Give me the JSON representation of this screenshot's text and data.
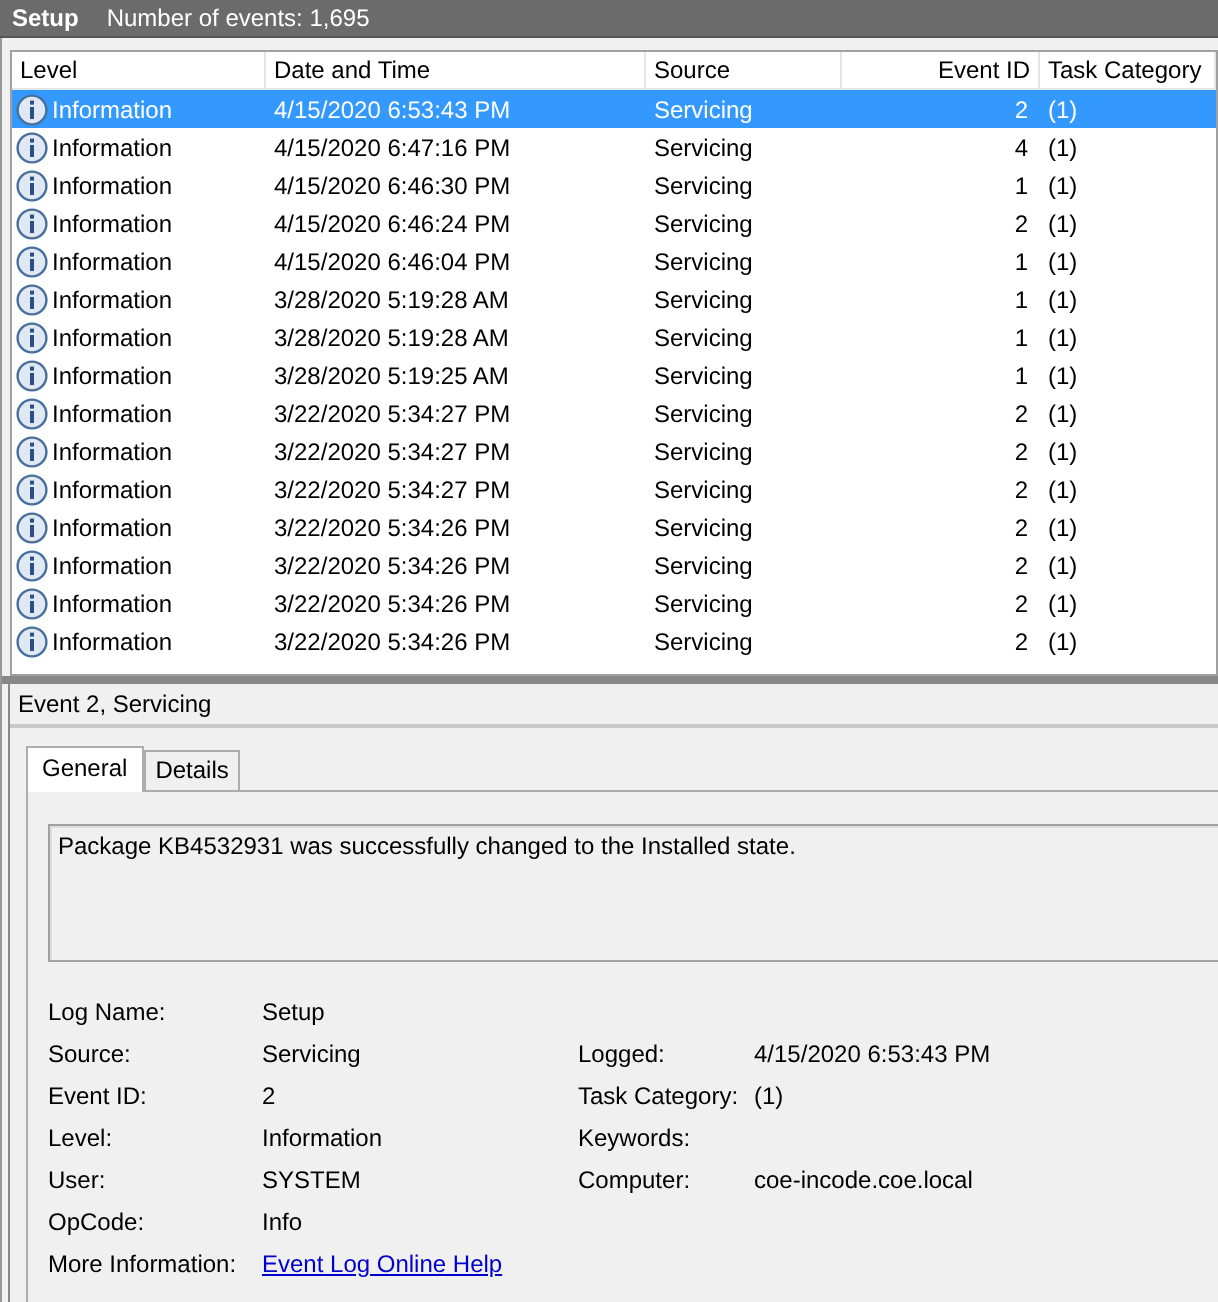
{
  "header": {
    "title": "Setup",
    "count": "Number of events: 1,695"
  },
  "table": {
    "columns": [
      "Level",
      "Date and Time",
      "Source",
      "Event ID",
      "Task Category"
    ],
    "rows": [
      {
        "level": "Information",
        "date": "4/15/2020 6:53:43 PM",
        "source": "Servicing",
        "event_id": "2",
        "task_category": "(1)",
        "selected": true
      },
      {
        "level": "Information",
        "date": "4/15/2020 6:47:16 PM",
        "source": "Servicing",
        "event_id": "4",
        "task_category": "(1)",
        "selected": false
      },
      {
        "level": "Information",
        "date": "4/15/2020 6:46:30 PM",
        "source": "Servicing",
        "event_id": "1",
        "task_category": "(1)",
        "selected": false
      },
      {
        "level": "Information",
        "date": "4/15/2020 6:46:24 PM",
        "source": "Servicing",
        "event_id": "2",
        "task_category": "(1)",
        "selected": false
      },
      {
        "level": "Information",
        "date": "4/15/2020 6:46:04 PM",
        "source": "Servicing",
        "event_id": "1",
        "task_category": "(1)",
        "selected": false
      },
      {
        "level": "Information",
        "date": "3/28/2020 5:19:28 AM",
        "source": "Servicing",
        "event_id": "1",
        "task_category": "(1)",
        "selected": false
      },
      {
        "level": "Information",
        "date": "3/28/2020 5:19:28 AM",
        "source": "Servicing",
        "event_id": "1",
        "task_category": "(1)",
        "selected": false
      },
      {
        "level": "Information",
        "date": "3/28/2020 5:19:25 AM",
        "source": "Servicing",
        "event_id": "1",
        "task_category": "(1)",
        "selected": false
      },
      {
        "level": "Information",
        "date": "3/22/2020 5:34:27 PM",
        "source": "Servicing",
        "event_id": "2",
        "task_category": "(1)",
        "selected": false
      },
      {
        "level": "Information",
        "date": "3/22/2020 5:34:27 PM",
        "source": "Servicing",
        "event_id": "2",
        "task_category": "(1)",
        "selected": false
      },
      {
        "level": "Information",
        "date": "3/22/2020 5:34:27 PM",
        "source": "Servicing",
        "event_id": "2",
        "task_category": "(1)",
        "selected": false
      },
      {
        "level": "Information",
        "date": "3/22/2020 5:34:26 PM",
        "source": "Servicing",
        "event_id": "2",
        "task_category": "(1)",
        "selected": false
      },
      {
        "level": "Information",
        "date": "3/22/2020 5:34:26 PM",
        "source": "Servicing",
        "event_id": "2",
        "task_category": "(1)",
        "selected": false
      },
      {
        "level": "Information",
        "date": "3/22/2020 5:34:26 PM",
        "source": "Servicing",
        "event_id": "2",
        "task_category": "(1)",
        "selected": false
      },
      {
        "level": "Information",
        "date": "3/22/2020 5:34:26 PM",
        "source": "Servicing",
        "event_id": "2",
        "task_category": "(1)",
        "selected": false
      }
    ]
  },
  "detail": {
    "title": "Event 2, Servicing",
    "tabs": [
      {
        "label": "General",
        "selected": true
      },
      {
        "label": "Details",
        "selected": false
      }
    ],
    "message": "Package KB4532931 was successfully changed to the Installed state.",
    "fields": [
      {
        "label": "Log Name:",
        "value": "Setup"
      },
      {
        "label": "Source:",
        "value": "Servicing",
        "label2": "Logged:",
        "value2": "4/15/2020 6:53:43 PM"
      },
      {
        "label": "Event ID:",
        "value": "2",
        "label2": "Task Category:",
        "value2": "(1)"
      },
      {
        "label": "Level:",
        "value": "Information",
        "label2": "Keywords:"
      },
      {
        "label": "User:",
        "value": "SYSTEM",
        "label2": "Computer:",
        "value2": "coe-incode.coe.local"
      },
      {
        "label": "OpCode:",
        "value": "Info"
      },
      {
        "label": "More Information:",
        "link": "Event Log Online Help"
      }
    ]
  }
}
